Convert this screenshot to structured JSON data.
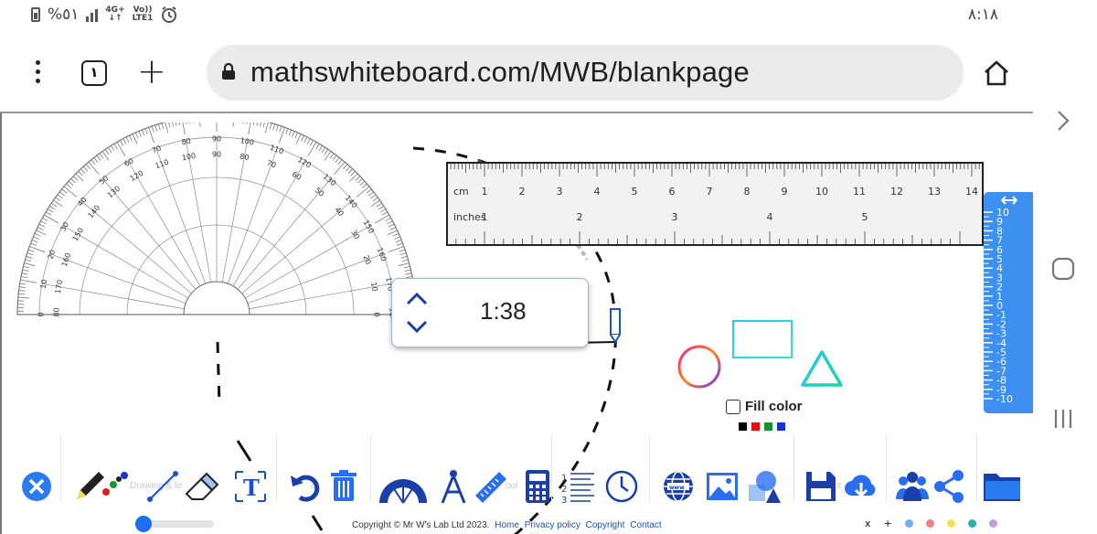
{
  "status": {
    "battery": "%٥١",
    "network": "4G+",
    "volte": "Vo))",
    "lte": "LTE1",
    "time": "٨:١٨"
  },
  "browser": {
    "tab_count": "١",
    "url": "mathswhiteboard.com/MWB/blankpage"
  },
  "ruler": {
    "cm_label": "cm",
    "cm_ticks": [
      "1",
      "2",
      "3",
      "4",
      "5",
      "6",
      "7",
      "8",
      "9",
      "10",
      "11",
      "12",
      "13",
      "14"
    ],
    "inch_label": "inches",
    "inch_ticks": [
      "1",
      "2",
      "3",
      "4",
      "5"
    ]
  },
  "protractor": {
    "outer_labels": [
      "0",
      "10",
      "20",
      "30",
      "40",
      "50",
      "60",
      "70",
      "80",
      "90",
      "100",
      "110",
      "120",
      "130",
      "140",
      "150",
      "160",
      "170",
      "180"
    ]
  },
  "timer": {
    "value": "1:38"
  },
  "vertical_ruler": {
    "labels": [
      "10",
      "9",
      "8",
      "7",
      "6",
      "5",
      "4",
      "3",
      "2",
      "1",
      "0",
      "-1",
      "-2",
      "-3",
      "-4",
      "-5",
      "-6",
      "-7",
      "-8",
      "-9",
      "-10"
    ]
  },
  "shapes_panel": {
    "fill_label": "Fill color",
    "colors": [
      "#000000",
      "#e01010",
      "#1a8f2a",
      "#1533d6"
    ]
  },
  "toolbar": {
    "faint_labels": [
      "Drawing & te",
      "al",
      "ool",
      "ut"
    ],
    "footer": {
      "copyright": "Copyright © Mr W's Lab Ltd 2023.",
      "links": [
        "Home",
        "Privacy policy",
        "Copyright",
        "Contact"
      ]
    },
    "bottom_right": {
      "close": "x",
      "add": "+"
    },
    "palette": [
      "#6ab0ff",
      "#f08080",
      "#f5e24a",
      "#28b0a8",
      "#c39be0"
    ]
  }
}
